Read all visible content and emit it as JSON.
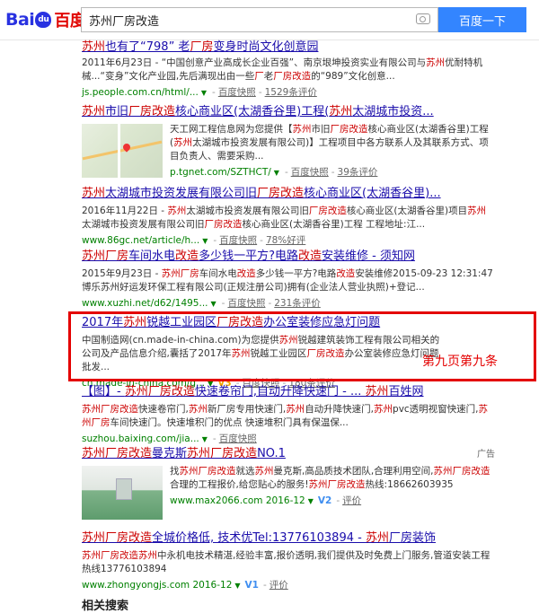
{
  "logo": {
    "text_left": "Bai",
    "paw": "du",
    "text_right": "百度"
  },
  "search": {
    "query": "苏州厂房改造",
    "button": "百度一下"
  },
  "results": [
    {
      "title": [
        [
          "苏州",
          true
        ],
        [
          "也有了“798” 老",
          false
        ],
        [
          "厂房",
          true
        ],
        [
          "变身时尚文化创意园",
          false
        ]
      ],
      "abstract": [
        [
          "2011年6月23日 - “中国创意产业高成长企业百强”、南京垠坤投资实业有限公司与",
          false
        ],
        [
          "苏州",
          true
        ],
        [
          "优耐特机械...“变身”文化产业园,先后满现出由一些",
          false
        ],
        [
          "厂",
          true
        ],
        [
          "老",
          false
        ],
        [
          "厂房",
          true
        ],
        [
          "改造",
          true
        ],
        [
          "的“989”文化创意...",
          false
        ]
      ],
      "url": "js.people.com.cn/html/...",
      "snapshot": "百度快照",
      "reviews": "1529条评价"
    },
    {
      "title": [
        [
          "苏州",
          true
        ],
        [
          "市旧",
          false
        ],
        [
          "厂房改造",
          true
        ],
        [
          "核心商业区(太湖香谷里)工程(",
          false
        ],
        [
          "苏州",
          true
        ],
        [
          "太湖城市投资...",
          false
        ]
      ],
      "abstract": [
        [
          "天工网工程信息网为您提供【",
          false
        ],
        [
          "苏州",
          true
        ],
        [
          "市旧",
          false
        ],
        [
          "厂房改造",
          true
        ],
        [
          "核心商业区(太湖香谷里)工程(",
          false
        ],
        [
          "苏州",
          true
        ],
        [
          "太湖城市投资发展有限公司)】工程项目中各方联系人及其联系方式、项目负责人、需要采购...",
          false
        ]
      ],
      "url": "p.tgnet.com/SZTHCT/",
      "snapshot": "百度快照",
      "reviews": "39条评价"
    },
    {
      "title": [
        [
          "苏州",
          true
        ],
        [
          "太湖城市投资发展有限公司旧",
          false
        ],
        [
          "厂房改造",
          true
        ],
        [
          "核心商业区(太湖香谷里)...",
          false
        ]
      ],
      "abstract": [
        [
          "2016年11月22日 - ",
          false
        ],
        [
          "苏州",
          true
        ],
        [
          "太湖城市投资发展有限公司旧",
          false
        ],
        [
          "厂房改造",
          true
        ],
        [
          "核心商业区(太湖香谷里)项目",
          false
        ],
        [
          "苏州",
          true
        ],
        [
          "太湖城市投资发展有限公司旧",
          false
        ],
        [
          "厂房改造",
          true
        ],
        [
          "核心商业区(太湖香谷里)工程 工程地址:江...",
          false
        ]
      ],
      "url": "www.86gc.net/article/h...",
      "snapshot": "百度快照",
      "reviews": "78%好评"
    },
    {
      "title": [
        [
          "苏州",
          true
        ],
        [
          "厂房",
          true
        ],
        [
          "车间水电",
          false
        ],
        [
          "改造",
          true
        ],
        [
          "多少钱一平方?电路",
          false
        ],
        [
          "改造",
          true
        ],
        [
          "安装维修 - 须知网",
          false
        ]
      ],
      "abstract": [
        [
          "2015年9月23日 - ",
          false
        ],
        [
          "苏州",
          true
        ],
        [
          "厂房",
          true
        ],
        [
          "车间水电",
          false
        ],
        [
          "改造",
          true
        ],
        [
          "多少钱一平方?电路",
          false
        ],
        [
          "改造",
          true
        ],
        [
          "安装维修2015-09-23 12:31:47 博乐苏州好运发环保工程有限公司(正规注册公司)拥有(企业法人营业执照)+登记...",
          false
        ]
      ],
      "url": "www.xuzhi.net/d62/1495...",
      "snapshot": "百度快照",
      "reviews": "231条评价"
    },
    {
      "title": [
        [
          "2017年",
          false
        ],
        [
          "苏州",
          true
        ],
        [
          "锐越工业园区",
          false
        ],
        [
          "厂房改造",
          true
        ],
        [
          "办公室装修应急灯问题",
          false
        ]
      ],
      "abstract": [
        [
          "中国制造网(cn.made-in-china.com)为您提供",
          false
        ],
        [
          "苏州",
          true
        ],
        [
          "锐越建筑装饰工程有限公司相关的公司及产品信息介绍,囊括了2017年",
          false
        ],
        [
          "苏州",
          true
        ],
        [
          "锐越工业园区",
          false
        ],
        [
          "厂房改造",
          true
        ],
        [
          "办公室装修应急灯问题批发...",
          false
        ]
      ],
      "url": "cn.made-in-china.com/g...",
      "vbadge": "V3",
      "snapshot": "百度快照",
      "reviews": "180条评价"
    },
    {
      "title": [
        [
          "【图】- ",
          false
        ],
        [
          "苏州",
          true
        ],
        [
          "厂房改造",
          true
        ],
        [
          "快速卷帘门,自动升降快速门 - ... ",
          false
        ],
        [
          "苏州",
          true
        ],
        [
          "百姓网",
          false
        ]
      ],
      "abstract": [
        [
          "苏州",
          true
        ],
        [
          "厂房改造",
          true
        ],
        [
          "快速卷帘门,",
          false
        ],
        [
          "苏州",
          true
        ],
        [
          "新厂房专用快速门,",
          false
        ],
        [
          "苏州",
          true
        ],
        [
          "自动升降快速门,",
          false
        ],
        [
          "苏州",
          true
        ],
        [
          "pvc透明视窗快速门,",
          false
        ],
        [
          "苏州",
          true
        ],
        [
          "厂房",
          true
        ],
        [
          "车间快速门。快速堆积门的优点 快速堆积门具有保温保...",
          false
        ]
      ],
      "url": "suzhou.baixing.com/jia...",
      "snapshot": "百度快照",
      "reviews": ""
    }
  ],
  "ads": [
    {
      "label": "广告",
      "title": [
        [
          "苏州",
          true
        ],
        [
          "厂房改造",
          true
        ],
        [
          "曼克斯",
          false
        ],
        [
          "苏州",
          true
        ],
        [
          "厂房改造",
          true
        ],
        [
          "NO.1",
          false
        ]
      ],
      "abstract": [
        [
          "找",
          false
        ],
        [
          "苏州",
          true
        ],
        [
          "厂房改造",
          true
        ],
        [
          "就选",
          false
        ],
        [
          "苏州",
          true
        ],
        [
          "曼克斯,高品质技术团队,合理利用空间,",
          false
        ],
        [
          "苏州",
          true
        ],
        [
          "厂房改造",
          true
        ],
        [
          "合理的工程报价,给您贴心的服务!",
          false
        ],
        [
          "苏州",
          true
        ],
        [
          "厂房改造",
          true
        ],
        [
          "热线:18662603935",
          false
        ]
      ],
      "url": "www.max2066.com",
      "date": "2016-12",
      "vbadge": "V2",
      "eval": "评价"
    },
    {
      "title": [
        [
          "苏州",
          true
        ],
        [
          "厂房改造",
          true
        ],
        [
          "全城价格低, 技术优Tel:13776103894 - ",
          false
        ],
        [
          "苏州",
          true
        ],
        [
          "厂房装饰",
          false
        ]
      ],
      "abstract": [
        [
          "苏州",
          true
        ],
        [
          "厂房改造",
          true
        ],
        [
          "苏州",
          true
        ],
        [
          "中永机电技术精湛,经验丰富,报价透明,我们提供及时免费上门服务,管道安装工程热线13776103894",
          false
        ]
      ],
      "url": "www.zhongyongjs.com",
      "date": "2016-12",
      "vbadge": "V1",
      "eval": "评价"
    }
  ],
  "annotation": "第九页第九条",
  "related_heading": "相关搜索"
}
